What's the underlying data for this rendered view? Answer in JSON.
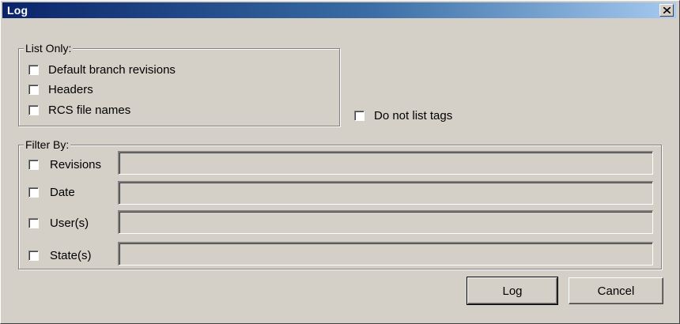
{
  "window": {
    "title": "Log",
    "close_icon": "close-icon"
  },
  "list_only": {
    "title": "List Only:",
    "options": [
      {
        "label": "Default branch revisions",
        "checked": false
      },
      {
        "label": "Headers",
        "checked": false
      },
      {
        "label": "RCS file names",
        "checked": false
      }
    ]
  },
  "do_not_list_tags": {
    "label": "Do not list tags",
    "checked": false
  },
  "filter_by": {
    "title": "Filter By:",
    "filters": [
      {
        "label": "Revisions",
        "checked": false,
        "value": ""
      },
      {
        "label": "Date",
        "checked": false,
        "value": ""
      },
      {
        "label": "User(s)",
        "checked": false,
        "value": ""
      },
      {
        "label": "State(s)",
        "checked": false,
        "value": ""
      }
    ]
  },
  "buttons": {
    "log_label": "Log",
    "cancel_label": "Cancel"
  }
}
